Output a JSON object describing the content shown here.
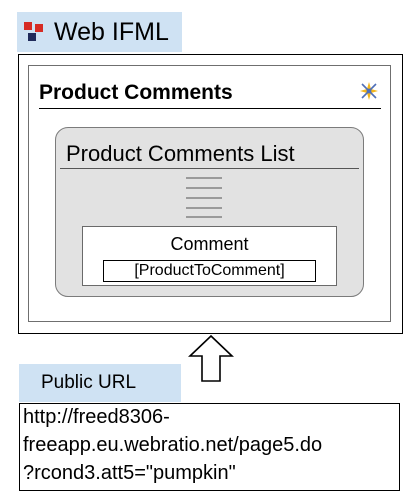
{
  "webml_tab": {
    "label": "Web IFML",
    "icon": "webml-logo-icon",
    "background": "#cfe2f3"
  },
  "page": {
    "title": "Product Comments",
    "landmark_icon": "landmark-icon"
  },
  "list_component": {
    "title": "Product Comments List",
    "icon": "list-lines-icon",
    "entity": {
      "name": "Comment",
      "condition": "[ProductToComment]"
    }
  },
  "arrow": {
    "icon": "up-arrow-icon"
  },
  "public_url": {
    "label": "Public URL",
    "lines": [
      "http://freed8306-",
      "freeapp.eu.webratio.net/page5.do",
      "?rcond3.att5=\"pumpkin\""
    ]
  },
  "colors": {
    "tab_background": "#cfe2f3",
    "list_background": "#e2e2e2",
    "logo_red": "#d62b24",
    "logo_navy": "#1f2a5a",
    "icon_yellow": "#f2b51b",
    "icon_blue": "#4f6fb8"
  }
}
